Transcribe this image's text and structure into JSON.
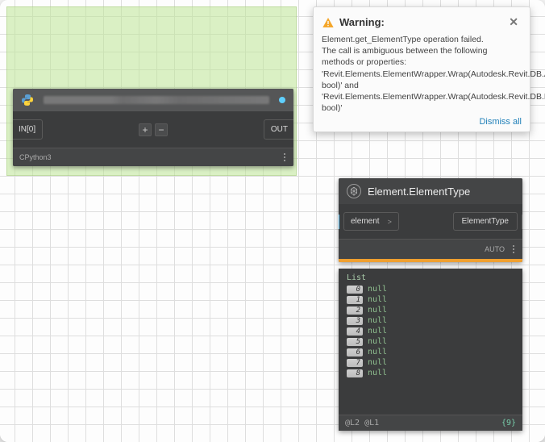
{
  "python_node": {
    "in_port": "IN[0]",
    "out_port": "OUT",
    "plus": "+",
    "minus": "−",
    "engine": "CPython3"
  },
  "element_node": {
    "title": "Element.ElementType",
    "in_port": "element",
    "arrow": ">",
    "out_port": "ElementType",
    "mode": "AUTO"
  },
  "list_panel": {
    "header": "List",
    "rows": [
      {
        "idx": "0",
        "val": "null"
      },
      {
        "idx": "1",
        "val": "null"
      },
      {
        "idx": "2",
        "val": "null"
      },
      {
        "idx": "3",
        "val": "null"
      },
      {
        "idx": "4",
        "val": "null"
      },
      {
        "idx": "5",
        "val": "null"
      },
      {
        "idx": "6",
        "val": "null"
      },
      {
        "idx": "7",
        "val": "null"
      },
      {
        "idx": "8",
        "val": "null"
      }
    ],
    "levels": "@L2 @L1",
    "count": "{9}"
  },
  "warning": {
    "title": "Warning:",
    "body": "Element.get_ElementType operation failed.\nThe call is ambiguous between the following methods or properties: 'Revit.Elements.ElementWrapper.Wrap(Autodesk.Revit.DB.AppearanceAssetElement, bool)' and 'Revit.Elements.ElementWrapper.Wrap(Autodesk.Revit.DB.FamilyInstance, bool)'",
    "dismiss": "Dismiss all"
  }
}
